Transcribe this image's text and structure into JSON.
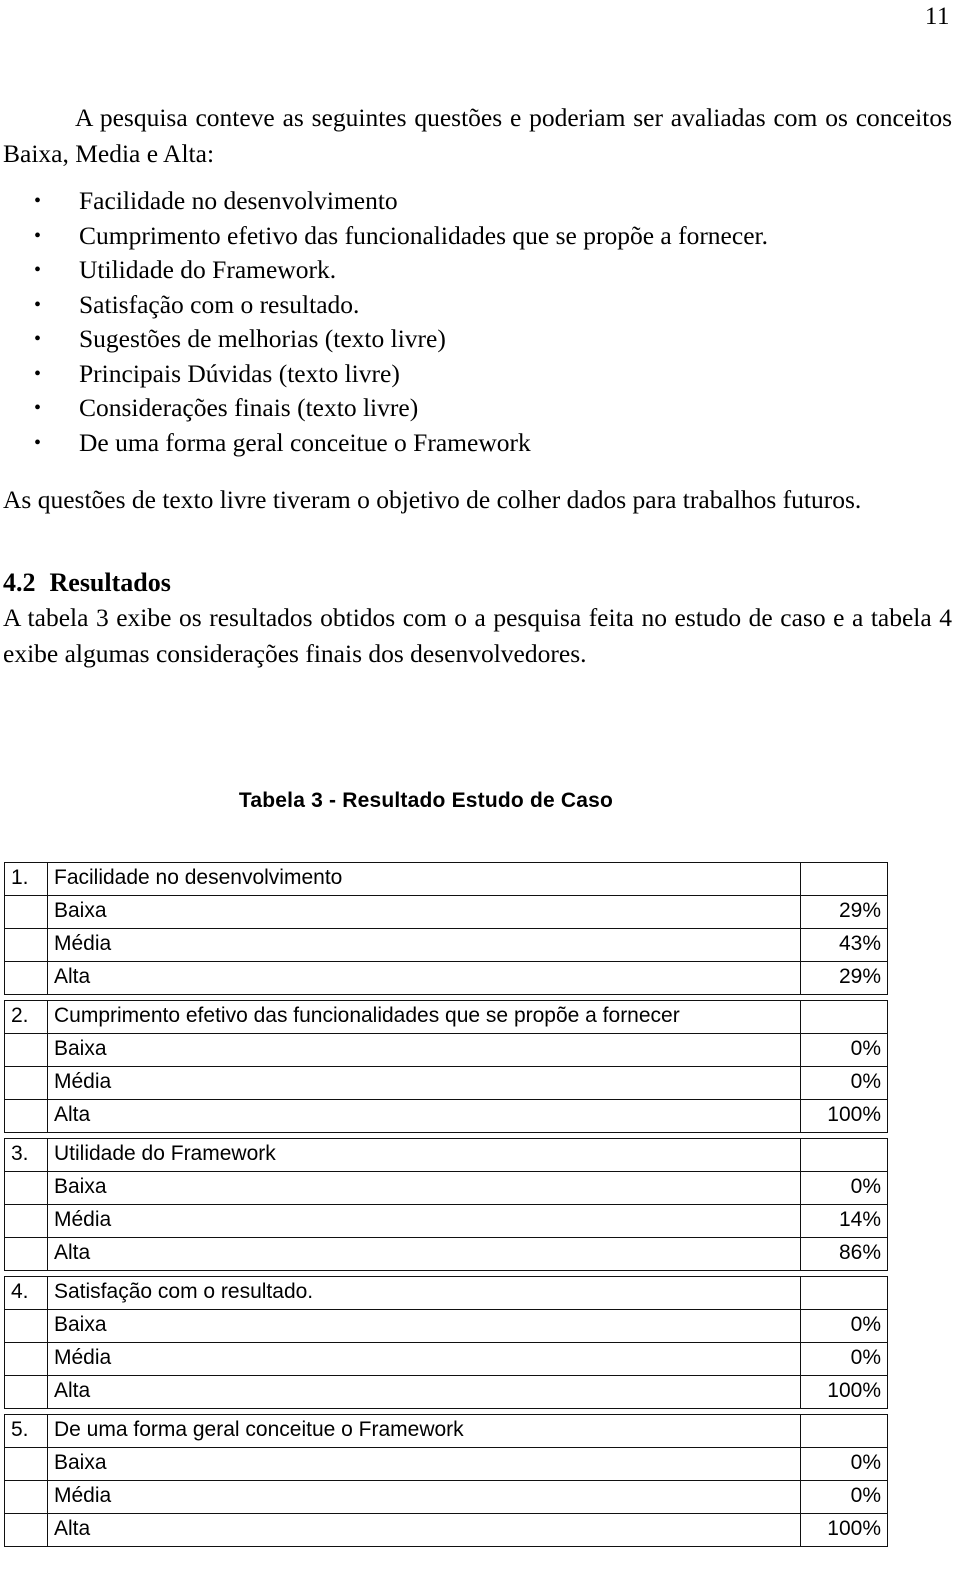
{
  "page": {
    "number": "11"
  },
  "intro": {
    "paragraph": "A pesquisa conteve as seguintes questões e poderiam ser avaliadas com os conceitos Baixa, Media e Alta:"
  },
  "bullets": [
    {
      "bullet": "•",
      "text": "Facilidade no desenvolvimento"
    },
    {
      "bullet": "•",
      "text": "Cumprimento efetivo das funcionalidades que se propõe a fornecer."
    },
    {
      "bullet": "•",
      "text": "Utilidade do Framework."
    },
    {
      "bullet": "•",
      "text": "Satisfação com o resultado."
    },
    {
      "bullet": "•",
      "text": "Sugestões de melhorias (texto livre)"
    },
    {
      "bullet": "•",
      "text": "Principais Dúvidas (texto livre)"
    },
    {
      "bullet": "•",
      "text": "Considerações finais (texto livre)"
    },
    {
      "bullet": "•",
      "text": "De uma forma geral conceitue o Framework"
    }
  ],
  "after_list": {
    "paragraph": "As questões de texto livre tiveram o objetivo de colher dados para trabalhos futuros."
  },
  "section": {
    "number": "4.2",
    "title": "Resultados",
    "paragraph": "A tabela 3 exibe os resultados obtidos com o a pesquisa feita no estudo de caso e a tabela 4 exibe algumas considerações finais dos desenvolvedores."
  },
  "table": {
    "caption": "Tabela 3 - Resultado Estudo de Caso",
    "blocks": [
      {
        "num": "1.",
        "question": "Facilidade no desenvolvimento",
        "rows": [
          {
            "label": "Baixa",
            "value": "29%"
          },
          {
            "label": "Média",
            "value": "43%"
          },
          {
            "label": "Alta",
            "value": "29%"
          }
        ]
      },
      {
        "num": "2.",
        "question": "Cumprimento efetivo das funcionalidades que se propõe a fornecer",
        "rows": [
          {
            "label": "Baixa",
            "value": "0%"
          },
          {
            "label": "Média",
            "value": "0%"
          },
          {
            "label": "Alta",
            "value": "100%"
          }
        ]
      },
      {
        "num": "3.",
        "question": "Utilidade do Framework",
        "rows": [
          {
            "label": "Baixa",
            "value": "0%"
          },
          {
            "label": "Média",
            "value": "14%"
          },
          {
            "label": "Alta",
            "value": "86%"
          }
        ]
      },
      {
        "num": "4.",
        "question": "Satisfação com o resultado.",
        "rows": [
          {
            "label": "Baixa",
            "value": "0%"
          },
          {
            "label": "Média",
            "value": "0%"
          },
          {
            "label": "Alta",
            "value": "100%"
          }
        ]
      },
      {
        "num": "5.",
        "question": "De uma forma geral conceitue o Framework",
        "rows": [
          {
            "label": "Baixa",
            "value": "0%"
          },
          {
            "label": "Média",
            "value": "0%"
          },
          {
            "label": "Alta",
            "value": "100%"
          }
        ]
      }
    ]
  }
}
